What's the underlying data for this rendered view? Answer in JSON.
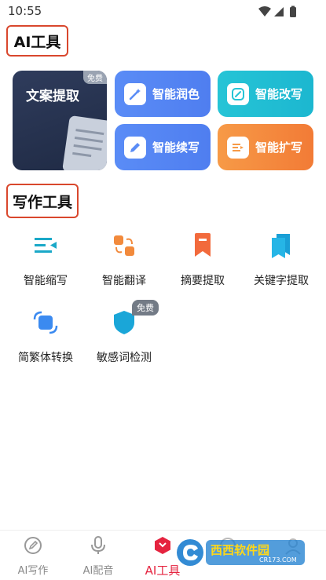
{
  "status": {
    "time": "10:55"
  },
  "sections": {
    "ai_tools": "AI工具",
    "writing_tools": "写作工具"
  },
  "big_card": {
    "title": "文案提取",
    "badge": "免费"
  },
  "tool_cards": [
    {
      "label": "智能润色",
      "icon": "magic-wand-icon",
      "color": "#5a8cf6"
    },
    {
      "label": "智能改写",
      "icon": "pen-edit-icon",
      "color": "#26c4d6"
    },
    {
      "label": "智能续写",
      "icon": "pencil-icon",
      "color": "#5a8cf6"
    },
    {
      "label": "智能扩写",
      "icon": "expand-list-icon",
      "color": "#f79a47"
    }
  ],
  "writing_tools": [
    {
      "label": "智能缩写",
      "icon": "shrink-list-icon"
    },
    {
      "label": "智能翻译",
      "icon": "translate-icon"
    },
    {
      "label": "摘要提取",
      "icon": "bookmark-icon"
    },
    {
      "label": "关键字提取",
      "icon": "bookmarks-icon"
    },
    {
      "label": "简繁体转换",
      "icon": "convert-icon"
    },
    {
      "label": "敏感词检测",
      "icon": "shield-icon"
    }
  ],
  "writing_badge": "免费",
  "bottom_nav": [
    {
      "label": "AI写作",
      "icon": "pen-circle-icon",
      "active": false
    },
    {
      "label": "AI配音",
      "icon": "microphone-icon",
      "active": false
    },
    {
      "label": "AI工具",
      "icon": "ai-tools-icon",
      "active": true
    },
    {
      "label": "",
      "icon": "nav-icon-4",
      "active": false
    },
    {
      "label": "",
      "icon": "nav-icon-5",
      "active": false
    }
  ],
  "watermark": {
    "text": "西西软件园",
    "subtext": "CR173.COM"
  },
  "colors": {
    "accent": "#e5233f",
    "highlight_border": "#d9472d",
    "blue": "#5a8cf6",
    "cyan": "#26c4d6",
    "orange": "#f79a47"
  }
}
